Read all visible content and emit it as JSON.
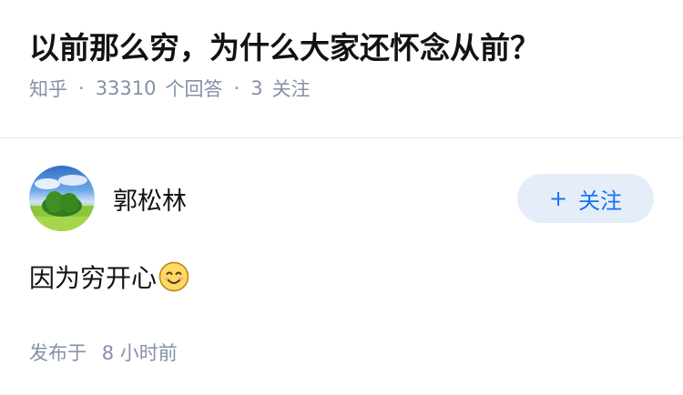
{
  "question": {
    "title": "以前那么穷，为什么大家还怀念从前？",
    "source": "知乎",
    "answer_count": "33310",
    "answer_label": "个回答",
    "follower_count": "3",
    "follower_label": "关注"
  },
  "answer": {
    "author_name": "郭松林",
    "follow_plus": "+",
    "follow_label": "关注",
    "content_text": "因为穷开心",
    "emoji_icon": "smiling-face-emoji",
    "published_label": "发布于",
    "published_time": "8 小时前"
  },
  "colors": {
    "meta_gray": "#8590a6",
    "accent_blue": "#1772f6",
    "follow_bg": "#e5eef8"
  }
}
